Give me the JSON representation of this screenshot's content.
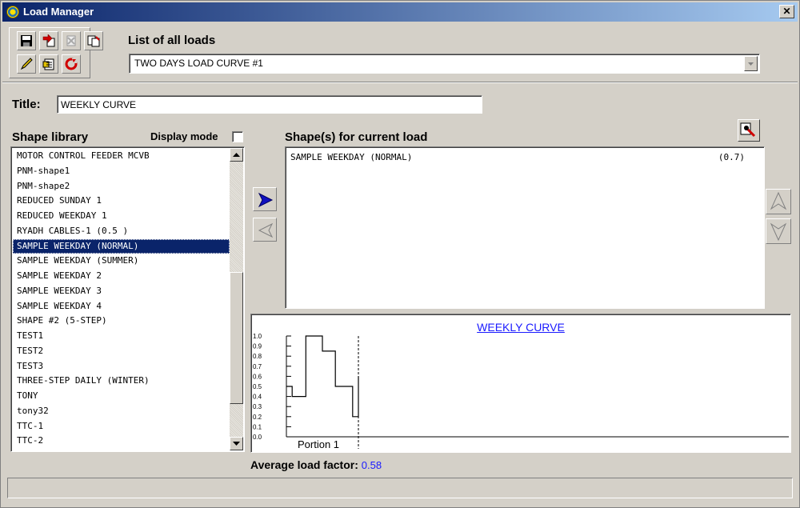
{
  "window": {
    "title": "Load Manager",
    "close_label": "✕"
  },
  "header": {
    "list_label": "List of all loads"
  },
  "loads_combo": {
    "selected": "TWO DAYS LOAD CURVE #1"
  },
  "title_field": {
    "label": "Title:",
    "value": "WEEKLY CURVE"
  },
  "library": {
    "label": "Shape library",
    "display_mode_label": "Display mode",
    "items": [
      "MOTOR CONTROL FEEDER MCVB",
      "PNM-shape1",
      "PNM-shape2",
      "REDUCED SUNDAY 1",
      "REDUCED WEEKDAY 1",
      "RYADH CABLES-1 (0.5 )",
      "SAMPLE WEEKDAY (NORMAL)",
      "SAMPLE WEEKDAY (SUMMER)",
      "SAMPLE WEEKDAY 2",
      "SAMPLE WEEKDAY 3",
      "SAMPLE WEEKDAY 4",
      "SHAPE #2 (5-STEP)",
      "TEST1",
      "TEST2",
      "TEST3",
      "THREE-STEP DAILY (WINTER)",
      "TONY",
      "tony32",
      "TTC-1",
      "TTC-2"
    ],
    "selected_index": 6
  },
  "current_shapes": {
    "label": "Shape(s)  for current load",
    "rows": [
      {
        "name": "SAMPLE WEEKDAY (NORMAL)",
        "factor": "(0.7)"
      }
    ]
  },
  "chart": {
    "title": "WEEKLY CURVE",
    "portion_label": "Portion 1"
  },
  "chart_data": {
    "type": "line",
    "title": "WEEKLY CURVE",
    "xlabel": "Portion 1",
    "ylabel": "",
    "ylim": [
      0,
      1.0
    ],
    "y_ticks": [
      "1.0",
      "0.9",
      "0.8",
      "0.7",
      "0.6",
      "0.5",
      "0.4",
      "0.3",
      "0.2",
      "0.1",
      "0.0"
    ],
    "step_fraction_x": [
      0,
      0.08,
      0.27,
      0.5,
      0.68,
      0.92,
      1.0
    ],
    "series": [
      {
        "values": [
          0.5,
          0.4,
          1.0,
          0.85,
          0.5,
          0.2,
          0.6
        ]
      }
    ]
  },
  "footer": {
    "avg_label": "Average load factor: ",
    "avg_value": "0.58"
  },
  "colors": {
    "title_bar": "#0a246a",
    "selection": "#0a246a",
    "link_blue": "#1a1aff",
    "face": "#d4d0c8"
  },
  "icons": [
    "save-icon",
    "copy-load-icon",
    "delete-load-icon",
    "paste-icon",
    "edit-pencil-icon",
    "notes-icon",
    "refresh-icon",
    "add-arrow-icon",
    "remove-arrow-icon",
    "move-up-icon",
    "move-down-icon",
    "export-icon"
  ]
}
